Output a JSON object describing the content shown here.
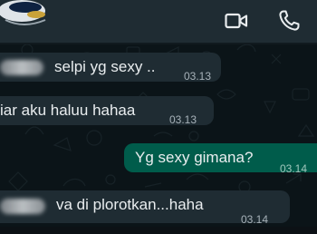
{
  "header": {
    "video_call_icon": "video-camera-icon",
    "voice_call_icon": "phone-icon",
    "avatar": "contact-avatar"
  },
  "messages": [
    {
      "direction": "incoming",
      "text": "selpi yg sexy ..",
      "time": "03.13",
      "sender_redacted": true
    },
    {
      "direction": "incoming",
      "text": "iar aku haluu hahaa",
      "time": "03.13",
      "sender_redacted": false
    },
    {
      "direction": "outgoing",
      "text": "Yg sexy gimana?",
      "time": "03.14",
      "sender_redacted": false
    },
    {
      "direction": "incoming",
      "text": "va di plorotkan...haha",
      "time": "03.14",
      "sender_redacted": true
    }
  ],
  "colors": {
    "header": "#1f2c33",
    "chat_background": "#0b1418",
    "incoming_bubble": "#1f2c33",
    "outgoing_bubble": "#005c4b",
    "text": "#e9edef",
    "timestamp": "#a7b2b9"
  }
}
